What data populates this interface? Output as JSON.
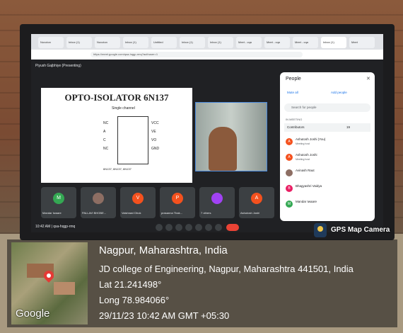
{
  "browser": {
    "tabs": [
      "Nuvoton",
      "Inbox (1)",
      "Nuvoton",
      "Inbox (1)",
      "Untitled",
      "Inbox (1)",
      "Inbox (1)",
      "Meet - cqa",
      "Meet - cqa",
      "Meet - cqa",
      "Inbox (1)",
      "Meet"
    ],
    "url": "https://meet.google.com/qsa-hqgp-rmq?authuser=1"
  },
  "meet": {
    "presenter": "Piyush Gajbhiye (Presenting)",
    "slide_title": "OPTO-ISOLATOR 6N137",
    "slide_subtitle": "Single channel",
    "pins_left": [
      "NC",
      "A",
      "C",
      "NC"
    ],
    "pins_right": [
      "VCC",
      "VE",
      "VO",
      "GND"
    ],
    "part_numbers": "6N137, 6N137, 6N137",
    "tiles": [
      {
        "initial": "M",
        "name": "Mandar Iwaare",
        "color": "#34a853"
      },
      {
        "initial": "",
        "name": "PALLAVI BHOBE...",
        "color": "#8d6e63"
      },
      {
        "initial": "V",
        "name": "Vaishnavi Dhok",
        "color": "#f4511e"
      },
      {
        "initial": "P",
        "name": "prasanna Thak...",
        "color": "#f4511e"
      },
      {
        "initial": "",
        "name": "7 others",
        "color": "#a142f4"
      },
      {
        "initial": "A",
        "name": "Ashutosh Joshi",
        "color": "#f4511e"
      }
    ],
    "time": "10:42 AM | qsa-hqgp-rmq"
  },
  "people_panel": {
    "title": "People",
    "mute_all": "Mute all",
    "add_people": "Add people",
    "search_placeholder": "Search for people",
    "section": "IN MEETING",
    "contributors": "Contributors",
    "contributors_count": "19",
    "people": [
      {
        "initial": "A",
        "name": "Ashutosh Joshi (You)",
        "sub": "Meeting host",
        "color": "#f4511e"
      },
      {
        "initial": "A",
        "name": "Ashutosh Joshi",
        "sub": "Meeting host",
        "color": "#f4511e"
      },
      {
        "initial": "",
        "name": "Avinash Raut",
        "sub": "",
        "color": "#8d6e63"
      },
      {
        "initial": "B",
        "name": "Bhagyashri Vaidya",
        "sub": "",
        "color": "#e91e63"
      },
      {
        "initial": "M",
        "name": "Mandar Iwaare",
        "sub": "",
        "color": "#34a853"
      }
    ]
  },
  "gps": {
    "badge": "GPS Map Camera",
    "google": "Google",
    "city": "Nagpur, Maharashtra, India",
    "address": "JD college of Engineering, Nagpur, Maharashtra 441501, India",
    "lat": "Lat 21.241498°",
    "long": "Long 78.984066°",
    "datetime": "29/11/23 10:42 AM GMT +05:30"
  }
}
